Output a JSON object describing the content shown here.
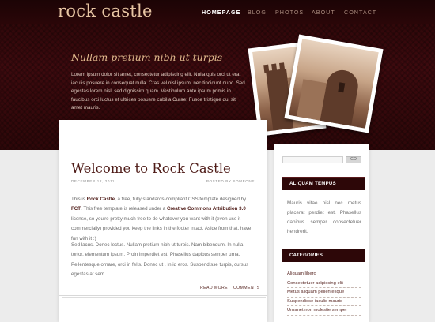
{
  "site": {
    "logo": "rock castle"
  },
  "nav": {
    "items": [
      "HOMEPAGE",
      "BLOG",
      "PHOTOS",
      "ABOUT",
      "CONTACT"
    ],
    "active": "HOMEPAGE"
  },
  "hero": {
    "tagline": "Nullam pretium nibh ut turpis",
    "intro": "Lorem ipsum dolor sit amet, consectetur adipiscing elit. Nulla quis orci ut erat iaculis posuere in consequat nulla. Cras vel nisl ipsum, nec tincidunt nunc. Sed egestas lorem nisl, sed dignissim quam. Vestibulum ante ipsum primis in faucibus orci luctus et ultrices posuere cubilia Curae; Fusce tristique dui sit amet mauris."
  },
  "post": {
    "title": "Welcome to Rock Castle",
    "date": "DECEMBER 12, 2011",
    "author": "POSTED BY SOMEONE",
    "p1_pre": "This is ",
    "p1_name": "Rock Castle",
    "p1_mid": ", a free, fully standards-compliant CSS template designed by ",
    "p1_fct": "FCT",
    "p1_mid2": ". This free template is released under a ",
    "p1_license": "Creative Commons Attribution 3.0",
    "p1_post": " license, so you're pretty much free to do whatever you want with it (even use it commercially) provided you keep the links in the footer intact. Aside from that, have fun with it :)",
    "p2": "Sed lacus. Donec lectus. Nullam pretium nibh ut turpis. Nam bibendum. In nulla tortor, elementum ipsum. Proin imperdiet est. Phasellus dapibus semper urna. Pellentesque ornare, orci in felis. Donec ut . In id eros. Suspendisse turpis, cursus egestas at sem.",
    "read_more": "READ MORE",
    "comments": "COMMENTS"
  },
  "sidebar": {
    "search_button": "GO",
    "section1_title": "ALIQUAM TEMPUS",
    "section1_text": "Mauris vitae nisl nec metus placerat perdiet est. Phasellus dapibus semper consectetuer hendrerit.",
    "section2_title": "CATEGORIES",
    "categories": [
      "Aliquam libero",
      "Consectetuer adipiscing elit",
      "Metus aliquam pellentesque",
      "Suspendisse iaculis mauris",
      "Urnanet non molestie semper"
    ]
  },
  "colors": {
    "header_dark": "#2a0608",
    "accent": "#4e1b17",
    "logo": "#e7c5a3",
    "tagline": "#e0b98d"
  }
}
